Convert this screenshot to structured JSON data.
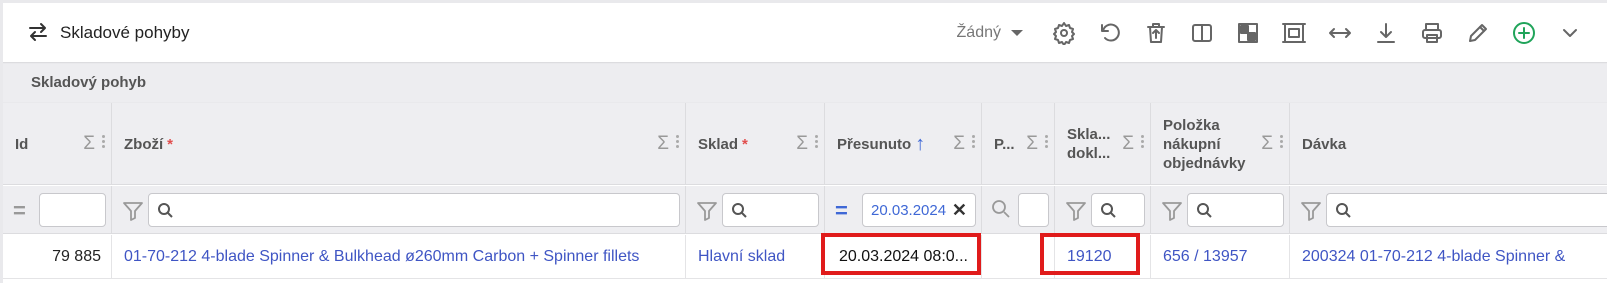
{
  "toolbar": {
    "title": "Skladové pohyby",
    "view_select": "Žádný",
    "icons": [
      "settings-icon",
      "undo-icon",
      "delete-icon",
      "columns-icon",
      "pattern-icon",
      "frame-icon",
      "width-icon",
      "download-icon",
      "print-icon",
      "edit-icon",
      "add-icon",
      "chevron-down-icon"
    ]
  },
  "section": {
    "title": "Skladový pohyb"
  },
  "columns": [
    {
      "label": "Id",
      "required": false
    },
    {
      "label": "Zboží",
      "required": true
    },
    {
      "label": "Sklad",
      "required": true
    },
    {
      "label": "Přesunuto",
      "required": false,
      "sorted": "asc"
    },
    {
      "label": "P...",
      "required": false
    },
    {
      "label": "Skla... dokl...",
      "required": false
    },
    {
      "label": "Položka nákupní objednávky",
      "required": false
    },
    {
      "label": "Dávka",
      "required": false
    }
  ],
  "filters": {
    "presunuto_value": "20.03.2024"
  },
  "row": {
    "id": "79 885",
    "zbozi": "01-70-212 4-blade Spinner & Bulkhead ø260mm Carbon + Spinner fillets",
    "sklad": "Hlavní sklad",
    "presunuto": "20.03.2024 08:0...",
    "p": "",
    "sklad_doklad": "19120",
    "polozka": "656 / 13957",
    "davka": "200324 01-70-212 4-blade Spinner &"
  },
  "colors": {
    "accent": "#3f68d6",
    "link": "#3f55c4",
    "highlight": "#e01b1b",
    "add": "#20a45a"
  }
}
